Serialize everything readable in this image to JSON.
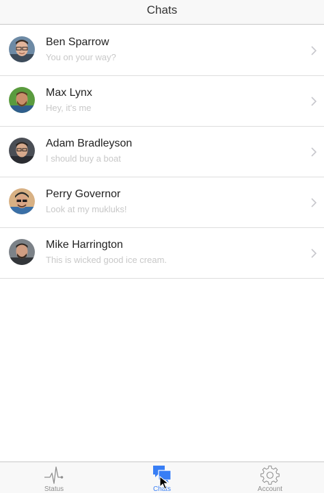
{
  "header": {
    "title": "Chats"
  },
  "chats": [
    {
      "name": "Ben Sparrow",
      "preview": "You on your way?"
    },
    {
      "name": "Max Lynx",
      "preview": "Hey, it's me"
    },
    {
      "name": "Adam Bradleyson",
      "preview": "I should buy a boat"
    },
    {
      "name": "Perry Governor",
      "preview": "Look at my mukluks!"
    },
    {
      "name": "Mike Harrington",
      "preview": "This is wicked good ice cream."
    }
  ],
  "tabs": [
    {
      "label": "Status",
      "icon": "pulse-icon",
      "active": false
    },
    {
      "label": "Chats",
      "icon": "chat-bubbles-icon",
      "active": true
    },
    {
      "label": "Account",
      "icon": "gear-icon",
      "active": false
    }
  ],
  "colors": {
    "accent": "#387ef5",
    "preview_text": "#c8c8c8",
    "tab_inactive": "#8e8e8e"
  }
}
